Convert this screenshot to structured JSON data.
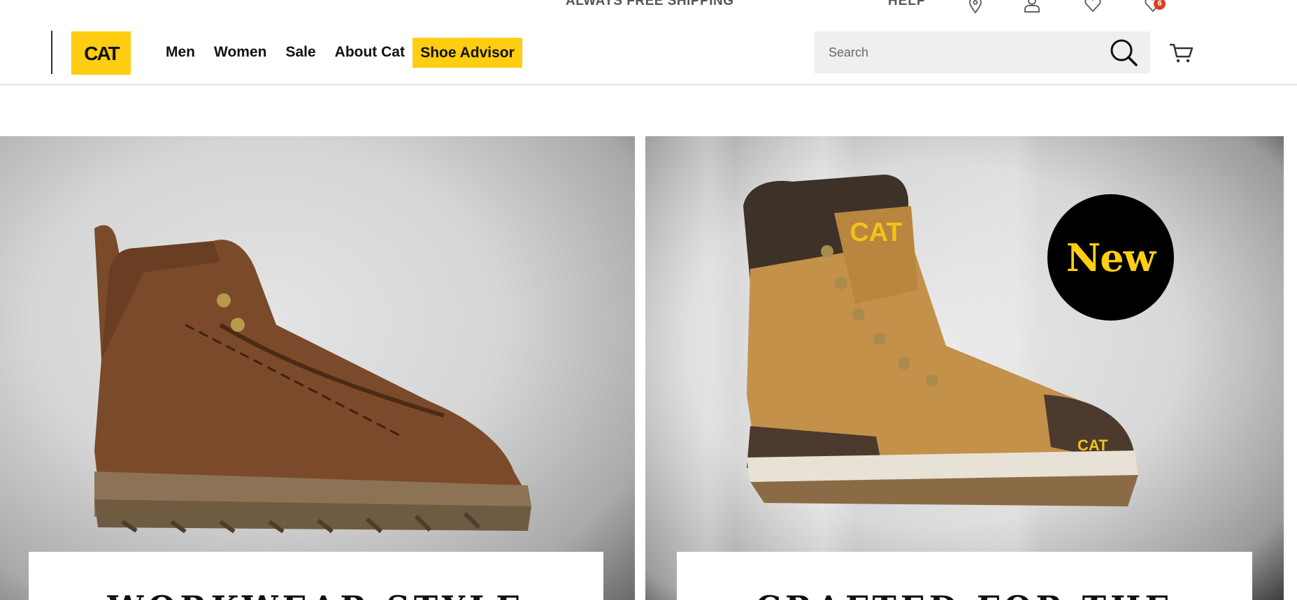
{
  "utility_bar": {
    "promo": "ALWAYS FREE SHIPPING",
    "help": "HELP",
    "icons": [
      "location-pin-icon",
      "user-account-icon",
      "wishlist-heart-icon",
      "saved-items-icon"
    ],
    "saved_count": "6",
    "badge_color": "#d9411e"
  },
  "header": {
    "logo_text": "CAT",
    "brand_color": "#ffcd11",
    "nav": [
      "Men",
      "Women",
      "Sale",
      "About Cat"
    ],
    "advisor": "Shoe Advisor",
    "search_placeholder": "Search",
    "icons": [
      "search-icon",
      "cart-icon"
    ]
  },
  "hero": {
    "cards": [
      {
        "image": "brown-leather-boot",
        "caption": "WORKWEAR STYLE"
      },
      {
        "image": "tan-safety-work-boot",
        "badge": "New",
        "caption": "CRAFTED FOR THE"
      }
    ]
  }
}
